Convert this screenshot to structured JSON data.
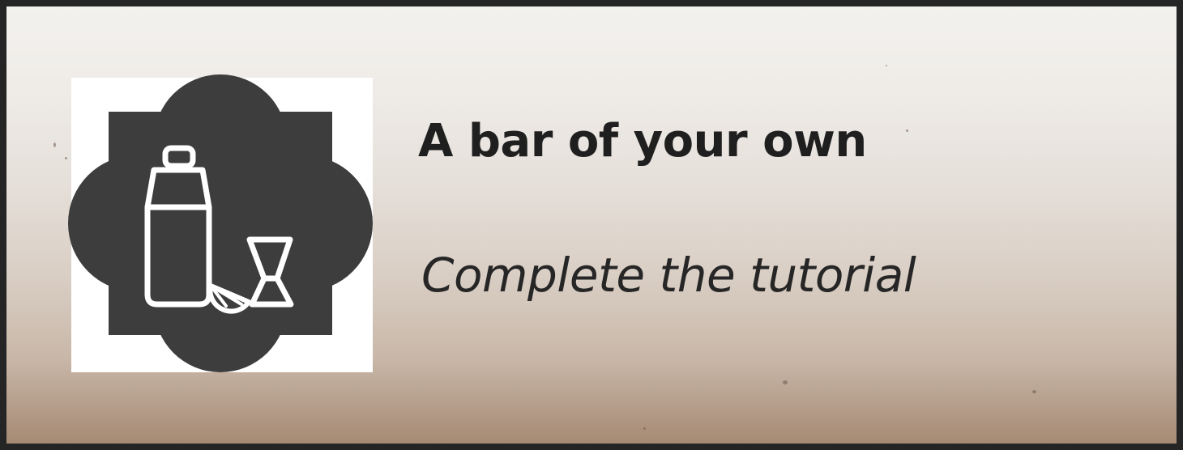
{
  "achievement": {
    "title": "A bar of your own",
    "description": "Complete the tutorial",
    "icon": "cocktail-shaker-lime-jigger-icon"
  },
  "colors": {
    "frame": "#252525",
    "emblem": "#3d3d3d",
    "icon_stroke": "#ffffff",
    "text": "#1f1f1f"
  }
}
